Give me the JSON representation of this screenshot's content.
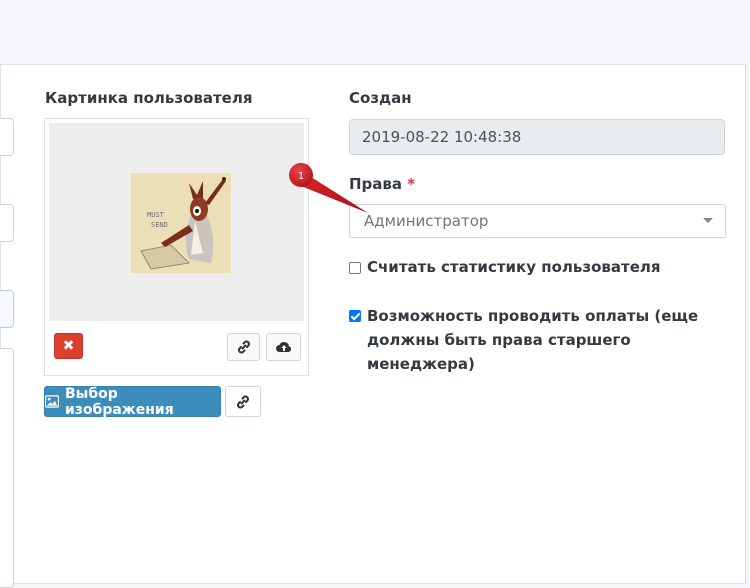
{
  "form": {
    "picture_label": "Картинка пользователя",
    "created_label": "Создан",
    "created_value": "2019-08-22 10:48:38",
    "rights_label": "Права",
    "rights_required": "*",
    "rights_selected": "Администратор",
    "stats_checkbox_label": "Считать статистику пользователя",
    "stats_checked": false,
    "payments_checkbox_label": "Возможность проводить оплаты (еще должны быть права старшего менеджера)",
    "payments_checked": true
  },
  "image_panel": {
    "remove_label": "✖",
    "choose_button_label": "Выбор изображения"
  },
  "annotation": {
    "marker_number": "1",
    "color": "#c8151a"
  },
  "colors": {
    "primary": "#3c8dbc",
    "danger": "#dd3f2f",
    "checkbox": "#0075ff",
    "required": "#dc3545"
  }
}
